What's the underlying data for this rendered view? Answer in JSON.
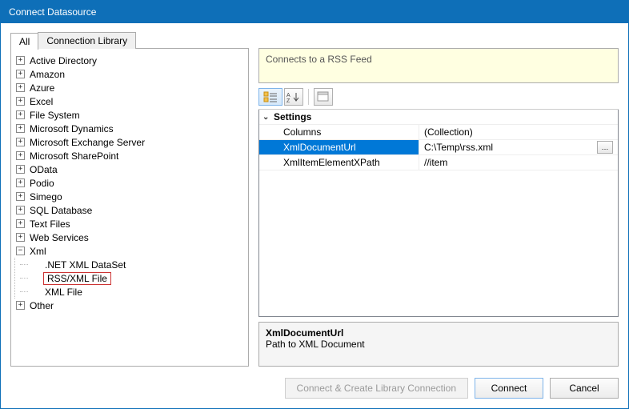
{
  "window": {
    "title": "Connect Datasource"
  },
  "tabs": {
    "all": "All",
    "library": "Connection Library"
  },
  "tree": {
    "items": [
      "Active Directory",
      "Amazon",
      "Azure",
      "Excel",
      "File System",
      "Microsoft Dynamics",
      "Microsoft Exchange Server",
      "Microsoft SharePoint",
      "OData",
      "Podio",
      "Simego",
      "SQL Database",
      "Text Files",
      "Web Services"
    ],
    "xml": {
      "label": "Xml",
      "children": [
        ".NET XML DataSet",
        "RSS/XML File",
        "XML File"
      ],
      "selected": "RSS/XML File"
    },
    "other": "Other"
  },
  "info": {
    "text": "Connects to a RSS Feed"
  },
  "toolbar": {
    "cat_icon": "☰",
    "az_icon": "A↓",
    "page_icon": "▭"
  },
  "propgrid": {
    "category": "Settings",
    "rows": [
      {
        "name": "Columns",
        "value": "(Collection)"
      },
      {
        "name": "XmlDocumentUrl",
        "value": "C:\\Temp\\rss.xml",
        "selected": true,
        "browse": true
      },
      {
        "name": "XmlItemElementXPath",
        "value": "//item"
      }
    ]
  },
  "propdesc": {
    "name": "XmlDocumentUrl",
    "text": "Path to XML Document"
  },
  "buttons": {
    "createlib": "Connect & Create Library Connection",
    "connect": "Connect",
    "cancel": "Cancel"
  },
  "glyphs": {
    "plus": "+",
    "minus": "−",
    "down": "⌄",
    "zsort": "z"
  }
}
